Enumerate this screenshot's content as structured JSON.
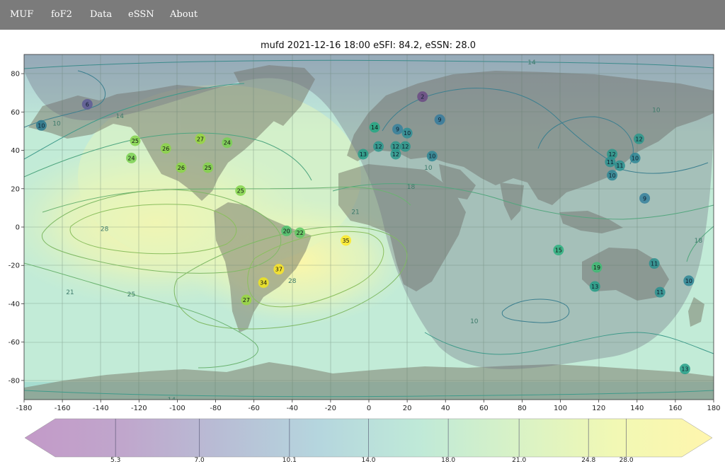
{
  "nav": {
    "items": [
      {
        "label": "MUF",
        "key": "muf"
      },
      {
        "label": "foF2",
        "key": "fof2"
      },
      {
        "label": "Data",
        "key": "data"
      },
      {
        "label": "eSSN",
        "key": "essn"
      },
      {
        "label": "About",
        "key": "about"
      }
    ]
  },
  "map": {
    "title": "mufd 2021-12-16 18:00 eSFI: 84.2, eSSN: 28.0",
    "x_ticks": [
      -180,
      -160,
      -140,
      -120,
      -100,
      -80,
      -60,
      -40,
      -20,
      0,
      20,
      40,
      60,
      80,
      100,
      120,
      140,
      160,
      180
    ],
    "y_ticks": [
      80,
      60,
      40,
      20,
      0,
      -20,
      -40,
      -60,
      -80
    ],
    "xlim": [
      -180,
      180
    ],
    "ylim": [
      -90,
      90
    ],
    "grid": true,
    "night_color": "#6d6d82",
    "land_color": "#7d806f",
    "contour_labels": [
      {
        "text": "14",
        "lon": 85,
        "lat": 86
      },
      {
        "text": "14",
        "lon": -130,
        "lat": 58
      },
      {
        "text": "10",
        "lon": -163,
        "lat": 54
      },
      {
        "text": "10",
        "lon": 31,
        "lat": 31
      },
      {
        "text": "18",
        "lon": 22,
        "lat": 21
      },
      {
        "text": "21",
        "lon": -7,
        "lat": 8
      },
      {
        "text": "28",
        "lon": -138,
        "lat": -1
      },
      {
        "text": "21",
        "lon": -156,
        "lat": -34
      },
      {
        "text": "25",
        "lon": -124,
        "lat": -35
      },
      {
        "text": "28",
        "lon": -40,
        "lat": -28
      },
      {
        "text": "10",
        "lon": 55,
        "lat": -49
      },
      {
        "text": "14",
        "lon": -103,
        "lat": -90
      },
      {
        "text": "18",
        "lon": 172,
        "lat": -7
      },
      {
        "text": "10",
        "lon": 150,
        "lat": 61
      },
      {
        "text": "10",
        "lon": -84,
        "lat": 31
      }
    ],
    "stations": [
      {
        "value": "10",
        "lon": -171,
        "lat": 53,
        "color": "#2a788e"
      },
      {
        "value": "6",
        "lon": -147,
        "lat": 64,
        "color": "#5e5a96"
      },
      {
        "value": "2",
        "lon": 28,
        "lat": 68,
        "color": "#6b4a84"
      },
      {
        "value": "9",
        "lon": 37,
        "lat": 56,
        "color": "#357a9c"
      },
      {
        "value": "14",
        "lon": 3,
        "lat": 52,
        "color": "#22a884"
      },
      {
        "value": "9",
        "lon": 15,
        "lat": 51,
        "color": "#35809c"
      },
      {
        "value": "10",
        "lon": 20,
        "lat": 49,
        "color": "#2d8e95"
      },
      {
        "value": "12",
        "lon": 5,
        "lat": 42,
        "color": "#29988d"
      },
      {
        "value": "13",
        "lon": -3,
        "lat": 38,
        "color": "#249f88"
      },
      {
        "value": "12",
        "lon": 14,
        "lat": 42,
        "color": "#2a988c"
      },
      {
        "value": "12",
        "lon": 19,
        "lat": 42,
        "color": "#2a988c"
      },
      {
        "value": "12",
        "lon": 14,
        "lat": 38,
        "color": "#2a988c"
      },
      {
        "value": "10",
        "lon": 33,
        "lat": 37,
        "color": "#2d8695"
      },
      {
        "value": "12",
        "lon": 141,
        "lat": 46,
        "color": "#2a988c"
      },
      {
        "value": "12",
        "lon": 127,
        "lat": 38,
        "color": "#2a988c"
      },
      {
        "value": "10",
        "lon": 139,
        "lat": 36,
        "color": "#2d8695"
      },
      {
        "value": "11",
        "lon": 126,
        "lat": 34,
        "color": "#2a918f"
      },
      {
        "value": "11",
        "lon": 131,
        "lat": 32,
        "color": "#2a918f"
      },
      {
        "value": "10",
        "lon": 127,
        "lat": 27,
        "color": "#2d8695"
      },
      {
        "value": "9",
        "lon": 144,
        "lat": 15,
        "color": "#35809c"
      },
      {
        "value": "25",
        "lon": -122,
        "lat": 45,
        "color": "#84d44b"
      },
      {
        "value": "26",
        "lon": -106,
        "lat": 41,
        "color": "#8bd646"
      },
      {
        "value": "27",
        "lon": -88,
        "lat": 46,
        "color": "#98d83e"
      },
      {
        "value": "24",
        "lon": -74,
        "lat": 44,
        "color": "#7ad151"
      },
      {
        "value": "24",
        "lon": -124,
        "lat": 36,
        "color": "#7ad151"
      },
      {
        "value": "26",
        "lon": -98,
        "lat": 31,
        "color": "#8bd646"
      },
      {
        "value": "25",
        "lon": -84,
        "lat": 31,
        "color": "#84d44b"
      },
      {
        "value": "25",
        "lon": -67,
        "lat": 19,
        "color": "#84d44b"
      },
      {
        "value": "20",
        "lon": -43,
        "lat": -2,
        "color": "#4cc26c"
      },
      {
        "value": "22",
        "lon": -36,
        "lat": -3,
        "color": "#5ec962"
      },
      {
        "value": "35",
        "lon": -12,
        "lat": -7,
        "color": "#fde725"
      },
      {
        "value": "37",
        "lon": -47,
        "lat": -22,
        "color": "#fde725"
      },
      {
        "value": "34",
        "lon": -55,
        "lat": -29,
        "color": "#f0e51c"
      },
      {
        "value": "27",
        "lon": -64,
        "lat": -38,
        "color": "#98d83e"
      },
      {
        "value": "15",
        "lon": 99,
        "lat": -12,
        "color": "#2cb07f"
      },
      {
        "value": "19",
        "lon": 119,
        "lat": -21,
        "color": "#3dbc74"
      },
      {
        "value": "13",
        "lon": 118,
        "lat": -31,
        "color": "#249f88"
      },
      {
        "value": "11",
        "lon": 149,
        "lat": -19,
        "color": "#2a918f"
      },
      {
        "value": "11",
        "lon": 152,
        "lat": -34,
        "color": "#2a918f"
      },
      {
        "value": "10",
        "lon": 167,
        "lat": -28,
        "color": "#2d8695"
      },
      {
        "value": "13",
        "lon": 165,
        "lat": -74,
        "color": "#249f88"
      }
    ]
  },
  "colorbar": {
    "ticks": [
      "5.3",
      "7.0",
      "10.1",
      "14.0",
      "18.0",
      "21.0",
      "24.8",
      "28.0"
    ],
    "tick_positions": [
      0.132,
      0.254,
      0.385,
      0.5,
      0.616,
      0.719,
      0.82,
      0.875
    ],
    "colors": [
      "#c39ac8",
      "#c0a6cc",
      "#b8bdd5",
      "#b5d6de",
      "#bfe9d8",
      "#d8f2c6",
      "#f1f8b4",
      "#fff6ad"
    ]
  }
}
